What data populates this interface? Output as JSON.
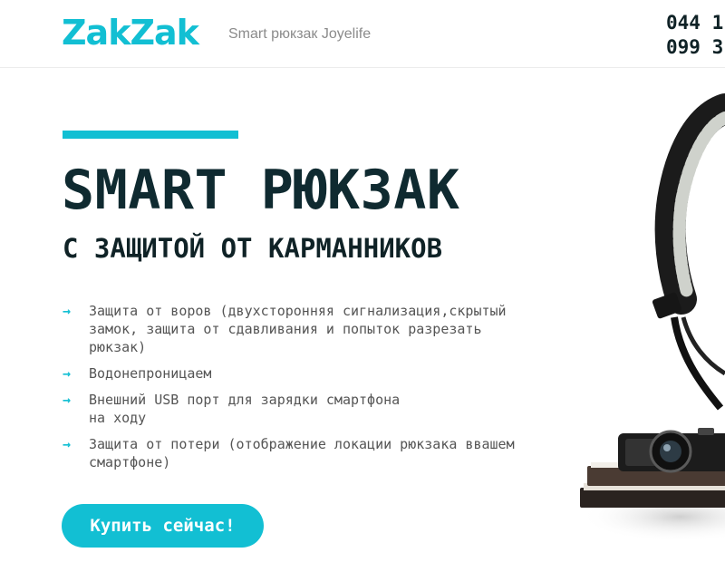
{
  "header": {
    "logo": "ZakZak",
    "tagline": "Smart рюкзак Joyelife",
    "phones": [
      "044 1",
      "099 3"
    ]
  },
  "hero": {
    "title": "SMART РЮКЗАК",
    "subtitle": "С ЗАЩИТОЙ ОТ КАРМАННИКОВ",
    "features": [
      {
        "icon": "arrow-right-icon",
        "lines": [
          "Защита от воров (двухсторонняя сигнализация,скрытый",
          "замок, защита от сдавливания и попыток разрезать",
          "рюкзак)"
        ]
      },
      {
        "icon": "arrow-right-icon",
        "lines": [
          "Водонепроницаем"
        ]
      },
      {
        "icon": "arrow-right-icon",
        "lines": [
          "Внешний USB порт для зарядки смартфона",
          "на ходу"
        ]
      },
      {
        "icon": "arrow-right-icon",
        "lines": [
          "Защита от потери (отображение локации рюкзака ввашем",
          "смартфоне)"
        ]
      }
    ],
    "button_label": "Купить сейчас!",
    "accent_color": "#12bfd3"
  }
}
